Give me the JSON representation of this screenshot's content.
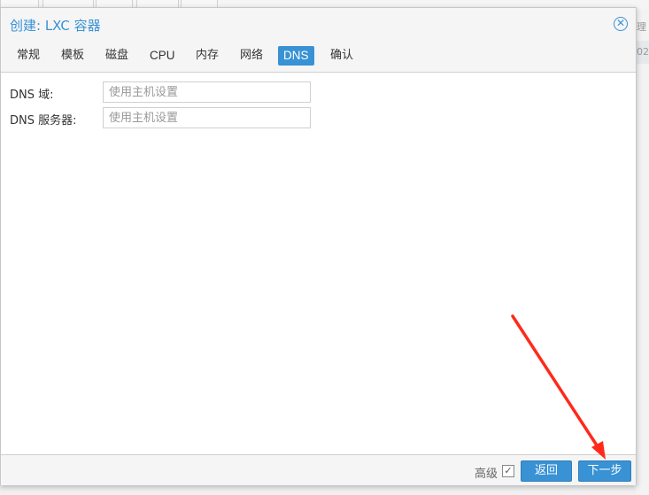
{
  "dialog": {
    "title": "创建: LXC 容器",
    "close_icon": "close-icon"
  },
  "tabs": [
    {
      "label": "常规"
    },
    {
      "label": "模板"
    },
    {
      "label": "磁盘"
    },
    {
      "label": "CPU"
    },
    {
      "label": "内存"
    },
    {
      "label": "网络"
    },
    {
      "label": "DNS",
      "active": true
    },
    {
      "label": "确认"
    }
  ],
  "form": {
    "dns_domain": {
      "label": "DNS 域:",
      "value": "",
      "placeholder": "使用主机设置"
    },
    "dns_servers": {
      "label": "DNS 服务器:",
      "value": "",
      "placeholder": "使用主机设置"
    }
  },
  "footer": {
    "advanced_label": "高级",
    "advanced_checked": true,
    "back_label": "返回",
    "next_label": "下一步"
  },
  "background": {
    "right_texts": [
      "理",
      "02"
    ]
  },
  "colors": {
    "accent": "#3892d4",
    "annotation_arrow": "#ff2a1a"
  }
}
